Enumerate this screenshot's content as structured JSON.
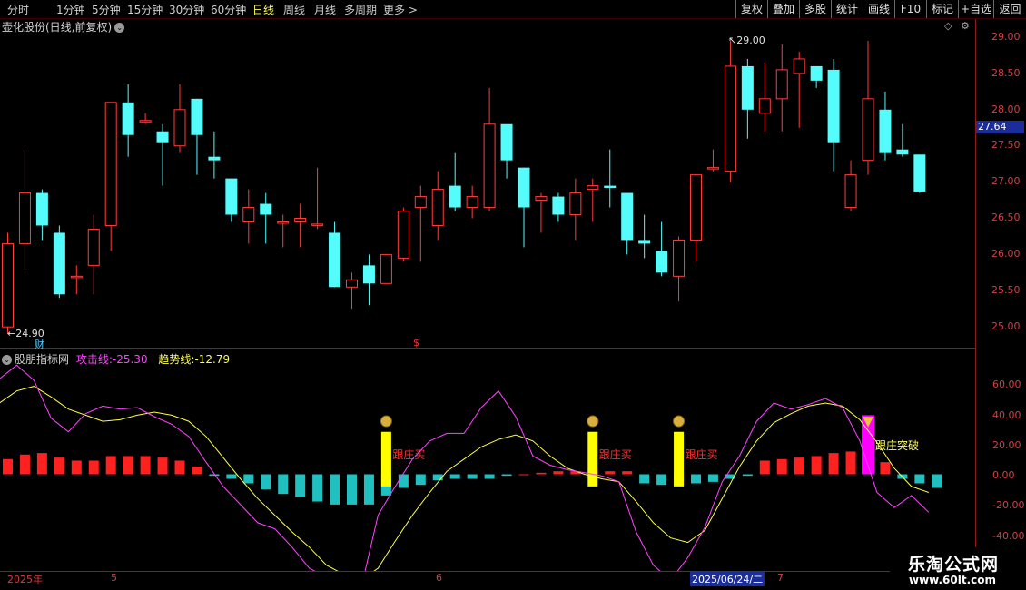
{
  "toolbar": {
    "periods": [
      "分时",
      "1分钟",
      "5分钟",
      "15分钟",
      "30分钟",
      "60分钟",
      "日线",
      "周线",
      "月线",
      "多周期",
      "更多"
    ],
    "active_period": "日线",
    "right_buttons": [
      "复权",
      "叠加",
      "多股",
      "统计",
      "画线",
      "F10",
      "标记",
      "+自选",
      "返回"
    ]
  },
  "main_chart": {
    "title": "壶化股份(日线,前复权)",
    "y_labels": [
      "29.00",
      "28.50",
      "28.00",
      "27.50",
      "27.00",
      "26.50",
      "26.00",
      "25.50",
      "25.00"
    ],
    "current_price": "27.64",
    "high_marker": "29.00",
    "low_marker": "24.90",
    "marker_cai": "财",
    "marker_dollar": "$",
    "colors": {
      "up": "#ff3c3c",
      "down": "#54fcfc"
    },
    "candles": [
      [
        25.0,
        26.15,
        26.3,
        24.9
      ],
      [
        26.15,
        26.85,
        27.45,
        25.8
      ],
      [
        26.85,
        26.4,
        26.9,
        26.2
      ],
      [
        26.3,
        25.45,
        26.4,
        25.4
      ],
      [
        25.7,
        25.7,
        25.85,
        25.45
      ],
      [
        25.85,
        26.35,
        26.55,
        25.45
      ],
      [
        26.4,
        28.1,
        28.1,
        26.05
      ],
      [
        28.1,
        27.65,
        28.35,
        27.35
      ],
      [
        27.85,
        27.85,
        27.95,
        27.8
      ],
      [
        27.7,
        27.55,
        27.8,
        26.95
      ],
      [
        27.5,
        28.0,
        28.35,
        27.4
      ],
      [
        28.15,
        27.65,
        28.15,
        27.1
      ],
      [
        27.35,
        27.3,
        27.7,
        27.05
      ],
      [
        27.05,
        26.55,
        27.05,
        26.45
      ],
      [
        26.45,
        26.65,
        26.9,
        26.15
      ],
      [
        26.7,
        26.55,
        26.85,
        26.15
      ],
      [
        26.45,
        26.45,
        26.55,
        26.1
      ],
      [
        26.45,
        26.5,
        26.7,
        26.1
      ],
      [
        26.42,
        26.42,
        27.2,
        26.35
      ],
      [
        26.3,
        25.55,
        26.45,
        25.55
      ],
      [
        25.55,
        25.65,
        25.75,
        25.25
      ],
      [
        25.85,
        25.6,
        26.0,
        25.3
      ],
      [
        25.6,
        26.0,
        26.0,
        25.6
      ],
      [
        25.95,
        26.6,
        26.65,
        25.9
      ],
      [
        26.65,
        26.8,
        26.95,
        25.9
      ],
      [
        26.4,
        26.9,
        27.15,
        26.2
      ],
      [
        26.95,
        26.65,
        27.4,
        26.6
      ],
      [
        26.65,
        26.8,
        26.95,
        26.5
      ],
      [
        26.65,
        27.8,
        28.3,
        26.6
      ],
      [
        27.8,
        27.3,
        27.75,
        27.05
      ],
      [
        27.2,
        26.65,
        27.2,
        26.1
      ],
      [
        26.75,
        26.8,
        26.85,
        26.3
      ],
      [
        26.8,
        26.55,
        26.85,
        26.45
      ],
      [
        26.55,
        26.85,
        27.05,
        26.2
      ],
      [
        26.9,
        26.95,
        27.05,
        26.45
      ],
      [
        26.95,
        26.92,
        27.45,
        26.65
      ],
      [
        26.85,
        26.2,
        26.85,
        26.0
      ],
      [
        26.2,
        26.15,
        26.55,
        25.95
      ],
      [
        26.05,
        25.75,
        26.45,
        25.7
      ],
      [
        25.7,
        26.2,
        26.25,
        25.35
      ],
      [
        26.2,
        27.1,
        27.1,
        25.9
      ],
      [
        27.2,
        27.2,
        27.45,
        27.15
      ],
      [
        27.15,
        28.6,
        28.95,
        27.0
      ],
      [
        28.6,
        28.0,
        28.7,
        27.6
      ],
      [
        27.95,
        28.15,
        28.65,
        27.7
      ],
      [
        28.15,
        28.55,
        28.9,
        27.7
      ],
      [
        28.5,
        28.7,
        28.8,
        27.75
      ],
      [
        28.6,
        28.4,
        28.6,
        28.3
      ],
      [
        28.55,
        27.55,
        28.7,
        27.15
      ],
      [
        26.65,
        27.1,
        27.3,
        26.6
      ],
      [
        27.3,
        28.15,
        28.95,
        27.1
      ],
      [
        28.0,
        27.4,
        28.25,
        27.3
      ],
      [
        27.45,
        27.38,
        27.8,
        27.35
      ],
      [
        27.38,
        26.87,
        27.38,
        26.85
      ]
    ]
  },
  "indicator": {
    "name": "股朋指标网",
    "attack_label": "攻击线:",
    "attack_value": "-25.30",
    "trend_label": "趋势线:",
    "trend_value": "-12.79",
    "y_labels": [
      "60.00",
      "40.00",
      "20.00",
      "0.00",
      "-20.00",
      "-40.00"
    ],
    "signal_label": "跟庄买",
    "breakout_label": "跟庄突破",
    "attack_line": [
      63,
      72,
      62,
      37,
      28,
      40,
      45,
      43,
      44,
      38,
      33,
      25,
      8,
      -8,
      -20,
      -32,
      -36,
      -48,
      -62,
      -68,
      -74,
      -76,
      -27,
      -8,
      10,
      22,
      27,
      27,
      44,
      55,
      38,
      12,
      6,
      3,
      1,
      -1,
      -5,
      -38,
      -60,
      -70,
      -55,
      -35,
      -5,
      12,
      35,
      47,
      43,
      46,
      50,
      44,
      22,
      -12,
      -22,
      -14,
      -25
    ],
    "trend_line": [
      47,
      55,
      58,
      51,
      43,
      39,
      35,
      36,
      39,
      41,
      39,
      35,
      25,
      11,
      -3,
      -16,
      -27,
      -38,
      -48,
      -60,
      -66,
      -70,
      -62,
      -44,
      -27,
      -12,
      2,
      10,
      18,
      23,
      26,
      22,
      12,
      4,
      0,
      -3,
      -5,
      -18,
      -32,
      -42,
      -45,
      -37,
      -16,
      5,
      22,
      34,
      40,
      45,
      47,
      45,
      36,
      21,
      4,
      -8,
      -12
    ],
    "histogram": [
      10,
      13,
      14,
      11,
      9,
      9,
      12,
      12,
      12,
      11,
      9,
      5,
      -1,
      -3,
      -6,
      -10,
      -13,
      -15,
      -18,
      -20,
      -20,
      -20,
      -14,
      -9,
      -7,
      -4,
      -3,
      -3,
      -3,
      -1,
      0,
      1,
      2,
      2,
      3,
      2,
      2,
      -6,
      -7,
      -7,
      -6,
      -5,
      -3,
      -1,
      9,
      10,
      11,
      12,
      14,
      15,
      11,
      8,
      -3,
      -6,
      -9
    ],
    "buy_signals": [
      22,
      34,
      39
    ],
    "breakout_signal": 50
  },
  "dates": {
    "year": "2025年",
    "month5": "5",
    "month6": "6",
    "month7": "7",
    "selected": "2025/06/24/二"
  },
  "watermark": {
    "line1": "乐淘公式网",
    "line2": "www.60lt.com"
  }
}
